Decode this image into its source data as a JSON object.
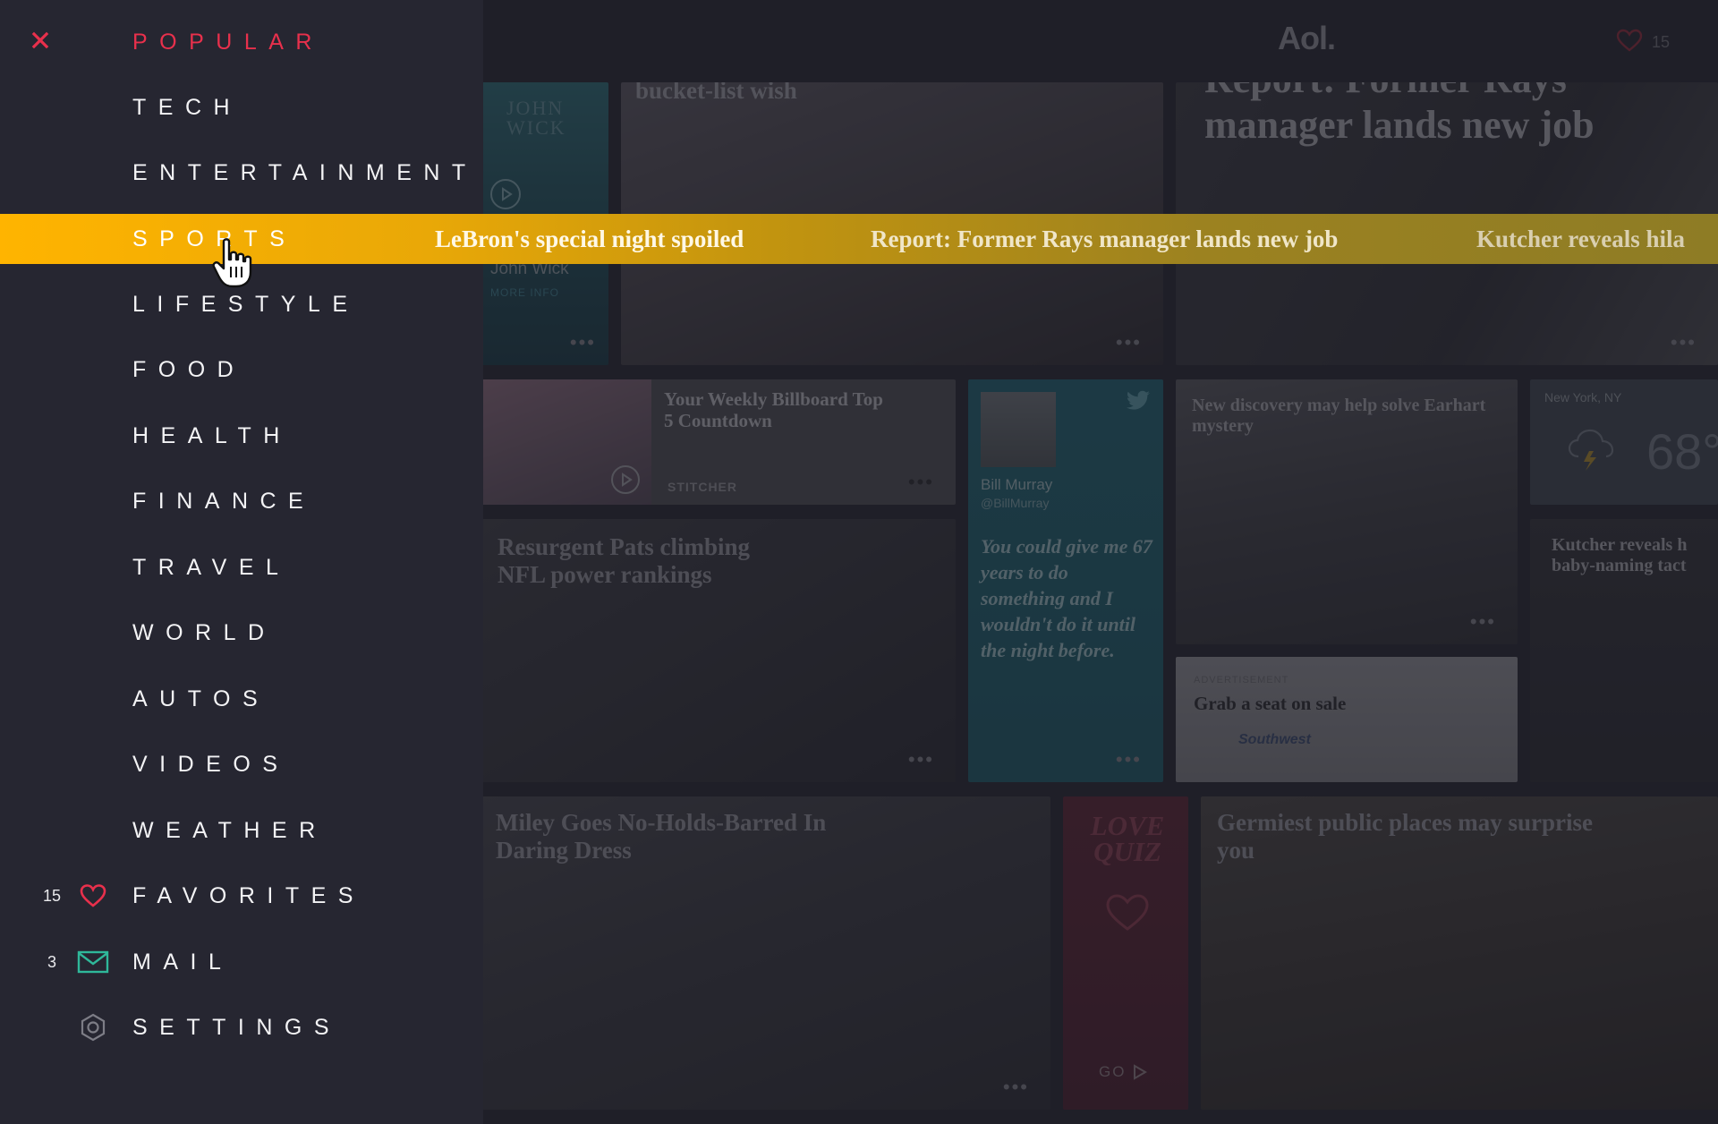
{
  "header": {
    "logo": "Aol.",
    "favorites_count": "15"
  },
  "sidebar": {
    "close_icon": "close-icon",
    "items": [
      {
        "label": "POPULAR",
        "active": true
      },
      {
        "label": "TECH"
      },
      {
        "label": "ENTERTAINMENT"
      },
      {
        "label": "SPORTS",
        "highlighted": true
      },
      {
        "label": "LIFESTYLE"
      },
      {
        "label": "FOOD"
      },
      {
        "label": "HEALTH"
      },
      {
        "label": "FINANCE"
      },
      {
        "label": "TRAVEL"
      },
      {
        "label": "WORLD"
      },
      {
        "label": "AUTOS"
      },
      {
        "label": "VIDEOS"
      },
      {
        "label": "WEATHER"
      },
      {
        "label": "FAVORITES",
        "count": "15",
        "icon": "heart-icon"
      },
      {
        "label": "MAIL",
        "count": "3",
        "icon": "mail-icon"
      },
      {
        "label": "SETTINGS",
        "icon": "settings-icon"
      }
    ]
  },
  "ticker": {
    "headlines": [
      "LeBron's special night spoiled",
      "Report: Former Rays manager lands new job",
      "Kutcher reveals hila"
    ]
  },
  "cards": {
    "movie": {
      "title": "John Wick",
      "subtitle": "MORE INFO",
      "poster_text": "JOHN WICK"
    },
    "bucket": {
      "title": "bucket-list wish"
    },
    "rays": {
      "title": "Report: Former Rays manager lands new job"
    },
    "billboard": {
      "title": "Your Weekly Billboard Top 5 Countdown",
      "brand": "STITCHER"
    },
    "tweet": {
      "name": "Bill Murray",
      "handle": "@BillMurray",
      "text": "You could give me 67 years to do something and I wouldn't do it until the night before."
    },
    "earhart": {
      "title": "New discovery may help solve Earhart mystery"
    },
    "weather": {
      "location": "New York, NY",
      "temp": "68°"
    },
    "kutcher": {
      "title": "Kutcher reveals h baby-naming tact"
    },
    "pats": {
      "title": "Resurgent Pats climbing NFL power rankings"
    },
    "ad": {
      "label": "ADVERTISEMENT",
      "title": "Grab a seat on sale",
      "brand": "Southwest"
    },
    "miley": {
      "title": "Miley Goes No-Holds-Barred In Daring Dress"
    },
    "quiz": {
      "title": "LOVE QUIZ",
      "cta": "GO"
    },
    "germs": {
      "title": "Germiest public places may surprise you"
    }
  },
  "colors": {
    "background": "#262631",
    "accent_red": "#e8304c",
    "highlight_yellow": "#ffb400",
    "mail_green": "#2fb89a",
    "tweet_teal": "#1f6c78"
  }
}
